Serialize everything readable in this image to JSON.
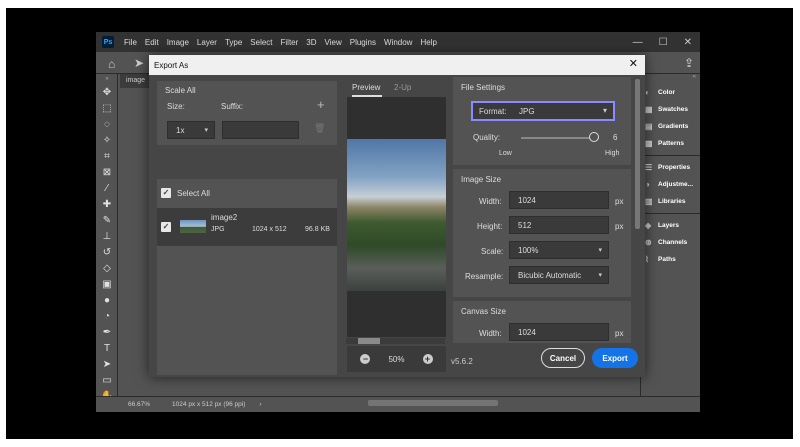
{
  "app": {
    "logo": "Ps",
    "menu": [
      "File",
      "Edit",
      "Image",
      "Layer",
      "Type",
      "Select",
      "Filter",
      "3D",
      "View",
      "Plugins",
      "Window",
      "Help"
    ],
    "window_controls": [
      "—",
      "☐",
      "✕"
    ],
    "doc_tab": "image",
    "status": {
      "zoom": "66.67%",
      "doc_info": "1024 px x 512 px (96 ppi)",
      "arrow": "›"
    }
  },
  "right_panels": {
    "group1": [
      {
        "icon": "palette-icon",
        "label": "Color"
      },
      {
        "icon": "grid-icon",
        "label": "Swatches"
      },
      {
        "icon": "gradient-icon",
        "label": "Gradients"
      },
      {
        "icon": "pattern-icon",
        "label": "Patterns"
      }
    ],
    "group2": [
      {
        "icon": "properties-icon",
        "label": "Properties"
      },
      {
        "icon": "adjustments-icon",
        "label": "Adjustme..."
      },
      {
        "icon": "libraries-icon",
        "label": "Libraries"
      }
    ],
    "group3": [
      {
        "icon": "layers-icon",
        "label": "Layers"
      },
      {
        "icon": "channels-icon",
        "label": "Channels"
      },
      {
        "icon": "paths-icon",
        "label": "Paths"
      }
    ]
  },
  "dialog": {
    "title": "Export As",
    "close": "✕",
    "scale_all": {
      "heading": "Scale All",
      "size_label": "Size:",
      "suffix_label": "Suffix:",
      "size_value": "1x",
      "suffix_value": "",
      "add": "+",
      "delete": "🗑"
    },
    "assets": {
      "select_all_label": "Select All",
      "items": [
        {
          "name": "image2",
          "format": "JPG",
          "dimensions": "1024 x 512",
          "size": "96.8 KB"
        }
      ]
    },
    "preview": {
      "tab_preview": "Preview",
      "tab_2up": "2-Up",
      "zoom": "50%",
      "minus": "−",
      "plus": "+"
    },
    "file_settings": {
      "heading": "File Settings",
      "format_label": "Format:",
      "format_value": "JPG",
      "quality_label": "Quality:",
      "quality_value": "6",
      "quality_low": "Low",
      "quality_high": "High"
    },
    "image_size": {
      "heading": "Image Size",
      "width_label": "Width:",
      "width_value": "1024",
      "height_label": "Height:",
      "height_value": "512",
      "scale_label": "Scale:",
      "scale_value": "100%",
      "resample_label": "Resample:",
      "resample_value": "Bicubic Automatic",
      "unit": "px"
    },
    "canvas_size": {
      "heading": "Canvas Size",
      "width_label": "Width:",
      "width_value": "1024",
      "unit": "px"
    },
    "version": "v5.6.2",
    "cancel_label": "Cancel",
    "export_label": "Export"
  }
}
